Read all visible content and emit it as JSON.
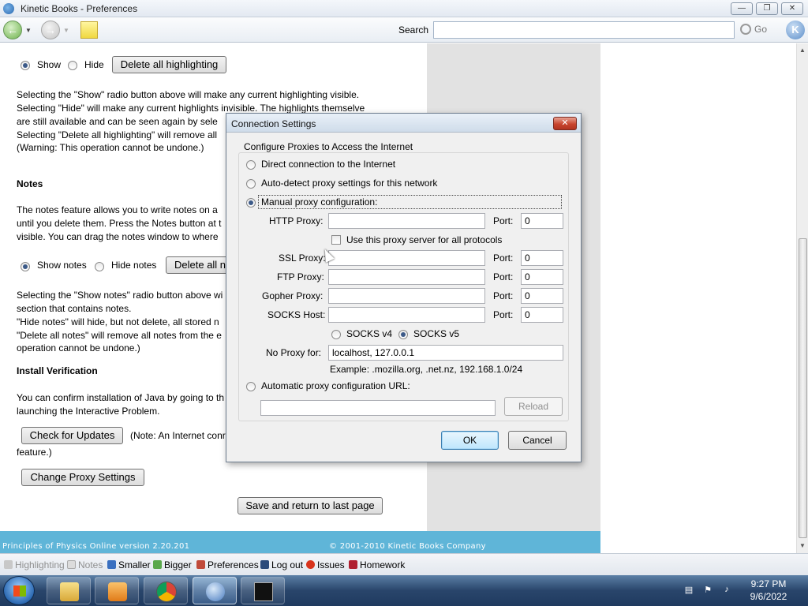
{
  "window": {
    "title": "Kinetic Books - Preferences",
    "minimize_label": "—",
    "maximize_label": "❐",
    "close_label": "✕"
  },
  "toolbar": {
    "back_icon": "←",
    "forward_icon": "→",
    "search_label": "Search",
    "search_value": "",
    "go_label": "Go",
    "logo_letter": "K"
  },
  "content": {
    "highlight": {
      "show_label": "Show",
      "hide_label": "Hide",
      "delete_button": "Delete all highlighting",
      "desc": [
        "Selecting the \"Show\" radio button above will make any current highlighting visible.",
        "Selecting \"Hide\" will make any current highlights invisible. The highlights themselve",
        "are still available and can be seen again by sele",
        "Selecting \"Delete all highlighting\" will remove all",
        "(Warning: This operation cannot be undone.)"
      ]
    },
    "notes": {
      "heading": "Notes",
      "desc": [
        "The notes feature allows you to write notes on a",
        "until you delete them. Press the Notes button at t",
        "visible. You can drag the notes window to where"
      ],
      "show_label": "Show notes",
      "hide_label": "Hide notes",
      "delete_button": "Delete all n",
      "desc2": [
        "Selecting the \"Show notes\" radio button above wi",
        "section that contains notes.",
        "\"Hide notes\" will hide, but not delete, all stored n",
        "\"Delete all notes\" will remove all notes from the e",
        "operation cannot be undone.)"
      ]
    },
    "install": {
      "heading": "Install Verification",
      "desc": [
        "You can confirm installation of Java by going to th",
        "launching the Interactive Problem."
      ],
      "check_button": "Check for Updates",
      "note": "(Note: An Internet conr",
      "note2": "feature.)",
      "proxy_button": "Change Proxy Settings",
      "save_button": "Save and return to last page"
    },
    "footer": {
      "left": "Principles of Physics Online version 2.20.201",
      "right": "© 2001-2010 Kinetic Books Company"
    }
  },
  "statusbar": {
    "items": [
      {
        "label": "Highlighting",
        "disabled": true
      },
      {
        "label": "Notes",
        "disabled": true
      },
      {
        "label": "Smaller",
        "disabled": false
      },
      {
        "label": "Bigger",
        "disabled": false
      },
      {
        "label": "Preferences",
        "disabled": false
      },
      {
        "label": "Log out",
        "disabled": false
      },
      {
        "label": "Issues",
        "disabled": false
      },
      {
        "label": "Homework",
        "disabled": false
      }
    ]
  },
  "dialog": {
    "title": "Connection Settings",
    "close_label": "✕",
    "group_label": "Configure Proxies to Access the Internet",
    "direct_label": "Direct connection to the Internet",
    "autodetect_label": "Auto-detect proxy settings for this network",
    "manual_label": "Manual proxy configuration:",
    "http_label": "HTTP Proxy:",
    "http_value": "",
    "port_label": "Port:",
    "http_port": "0",
    "use_all_label": "Use this proxy server for all protocols",
    "ssl_label": "SSL Proxy:",
    "ssl_value": "",
    "ssl_port": "0",
    "ftp_label": "FTP Proxy:",
    "ftp_value": "",
    "ftp_port": "0",
    "gopher_label": "Gopher Proxy:",
    "gopher_value": "",
    "gopher_port": "0",
    "socks_label": "SOCKS Host:",
    "socks_value": "",
    "socks_port": "0",
    "socks4_label": "SOCKS v4",
    "socks5_label": "SOCKS v5",
    "noproxy_label": "No Proxy for:",
    "noproxy_value": "localhost, 127.0.0.1",
    "example": "Example: .mozilla.org, .net.nz, 192.168.1.0/24",
    "autoconfig_label": "Automatic proxy configuration URL:",
    "autoconfig_value": "",
    "reload_button": "Reload",
    "ok_button": "OK",
    "cancel_button": "Cancel"
  },
  "taskbar": {
    "time": "9:27 PM",
    "date": "9/6/2022"
  }
}
